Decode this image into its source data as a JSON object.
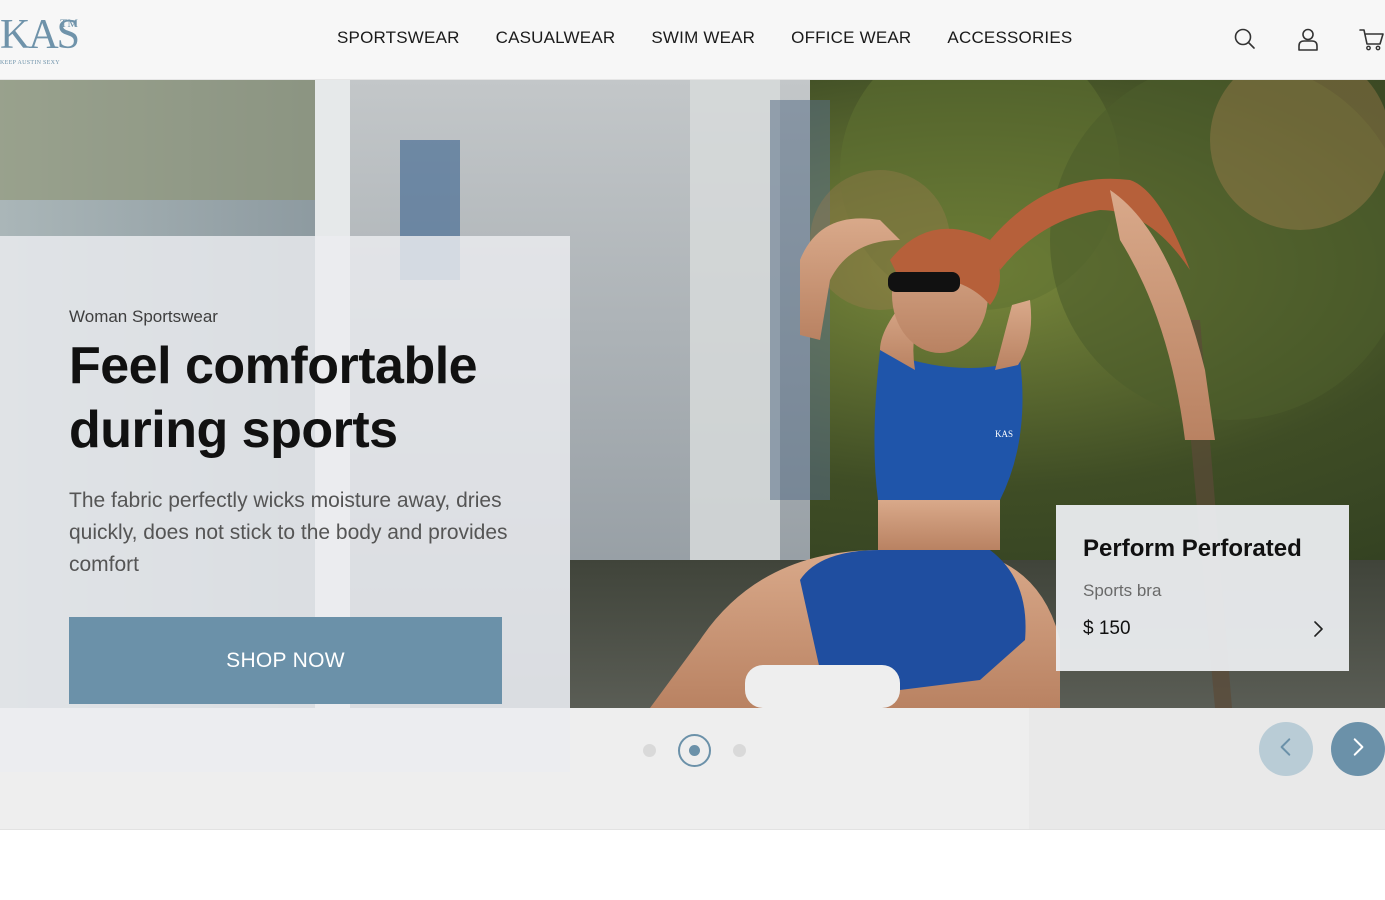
{
  "brand": {
    "logo_text": "KAS",
    "trademark": "TM",
    "tagline": "KEEP AUSTIN SEXY",
    "accent_color": "#6b91a9"
  },
  "nav": {
    "items": [
      "SPORTSWEAR",
      "CASUALWEAR",
      "SWIM WEAR",
      "OFFICE WEAR",
      "ACCESSORIES"
    ]
  },
  "header_icons": [
    "search-icon",
    "user-icon",
    "cart-icon"
  ],
  "hero": {
    "eyebrow": "Woman Sportswear",
    "title_line1": "Feel comfortable",
    "title_line2": "during sports",
    "description": "The fabric perfectly wicks moisture away, dries quickly, does not stick to the body and provides comfort",
    "cta_label": "SHOP NOW",
    "model_top_logo": "KAS"
  },
  "product_card": {
    "name": "Perform Perforated",
    "type": "Sports bra",
    "price": "$ 150"
  },
  "carousel": {
    "slide_count": 3,
    "active_slide": 2,
    "controls": [
      "chevron-left-icon",
      "chevron-right-icon"
    ]
  }
}
